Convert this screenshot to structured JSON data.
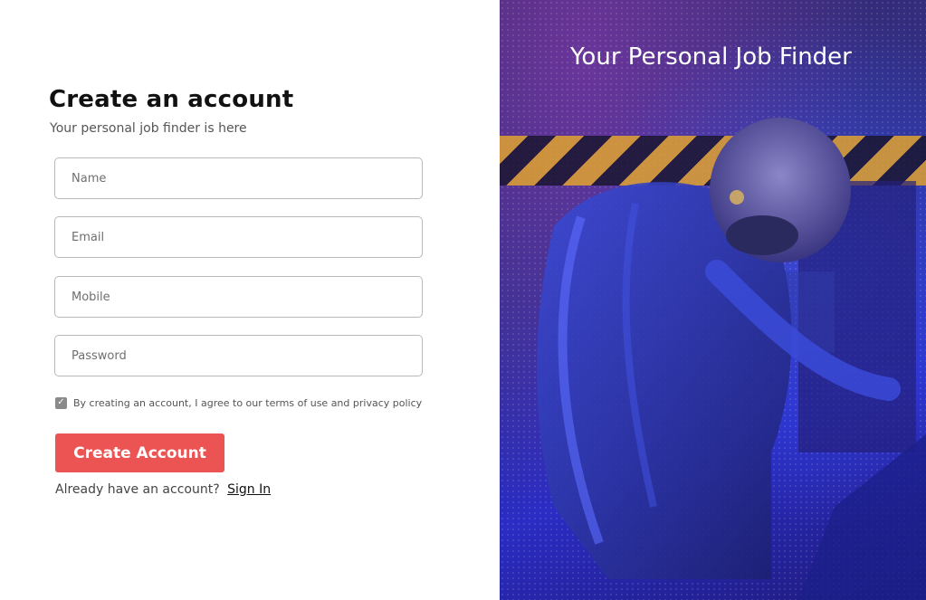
{
  "form": {
    "title": "Create an account",
    "subtitle": "Your personal job finder is here",
    "fields": {
      "name_placeholder": "Name",
      "email_placeholder": "Email",
      "mobile_placeholder": "Mobile",
      "password_placeholder": "Password"
    },
    "agree_text": "By creating an account, I agree to our terms of use and privacy policy",
    "agree_checked": true,
    "submit_label": "Create Account",
    "signin_prompt": "Already have an account?",
    "signin_link": "Sign In"
  },
  "hero": {
    "title": "Your Personal Job Finder"
  },
  "colors": {
    "accent": "#ec5353",
    "checkbox": "#8a8a8a"
  },
  "icons": {
    "checkbox": "check-icon"
  }
}
